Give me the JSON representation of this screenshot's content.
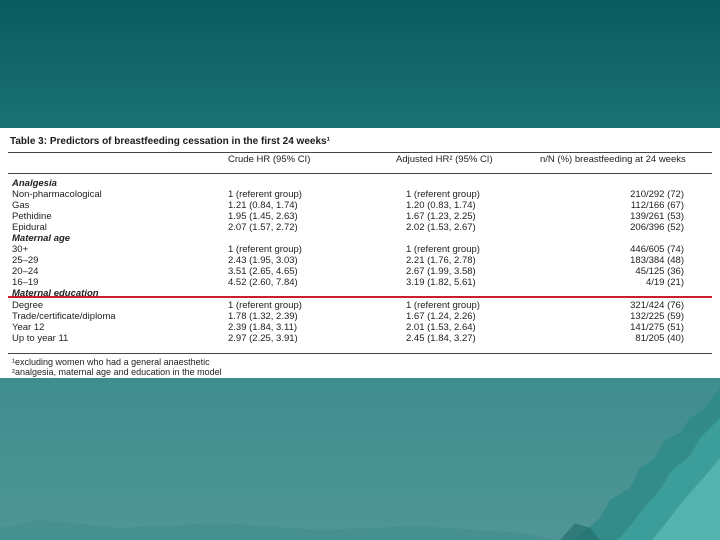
{
  "table": {
    "title": "Table 3: Predictors of breastfeeding cessation in the first 24 weeks¹",
    "columns": {
      "crude": "Crude HR (95% CI)",
      "adjusted": "Adjusted HR² (95% CI)",
      "n": "n/N (%) breastfeeding at 24 weeks"
    },
    "sections": [
      {
        "heading": "Analgesia",
        "rows": [
          {
            "label": "Non-pharmacological",
            "crude": "1 (referent group)",
            "adjusted": "1 (referent group)",
            "n": "210/292 (72)"
          },
          {
            "label": "Gas",
            "crude": "1.21 (0.84, 1.74)",
            "adjusted": "1.20 (0.83, 1.74)",
            "n": "112/166 (67)"
          },
          {
            "label": "Pethidine",
            "crude": "1.95 (1.45, 2.63)",
            "adjusted": "1.67 (1.23, 2.25)",
            "n": "139/261 (53)"
          },
          {
            "label": "Epidural",
            "crude": "2.07 (1.57, 2.72)",
            "adjusted": "2.02 (1.53, 2.67)",
            "n": "206/396 (52)"
          }
        ]
      },
      {
        "heading": "Maternal age",
        "rows": [
          {
            "label": "30+",
            "crude": "1 (referent group)",
            "adjusted": "1 (referent group)",
            "n": "446/605 (74)"
          },
          {
            "label": "25–29",
            "crude": "2.43 (1.95, 3.03)",
            "adjusted": "2.21 (1.76, 2.78)",
            "n": "183/384 (48)"
          },
          {
            "label": "20–24",
            "crude": "3.51 (2.65, 4.65)",
            "adjusted": "2.67 (1.99, 3.58)",
            "n": "45/125 (36)"
          },
          {
            "label": "16–19",
            "crude": "4.52 (2.60, 7.84)",
            "adjusted": "3.19 (1.82, 5.61)",
            "n": "4/19 (21)"
          }
        ]
      },
      {
        "heading": "Maternal education",
        "rows": [
          {
            "label": "Degree",
            "crude": "1 (referent group)",
            "adjusted": "1 (referent group)",
            "n": "321/424 (76)"
          },
          {
            "label": "Trade/certificate/diploma",
            "crude": "1.78 (1.32, 2.39)",
            "adjusted": "1.67 (1.24, 2.26)",
            "n": "132/225 (59)"
          },
          {
            "label": "Year 12",
            "crude": "2.39 (1.84, 3.11)",
            "adjusted": "2.01 (1.53, 2.64)",
            "n": "141/275 (51)"
          },
          {
            "label": "Up to year 11",
            "crude": "2.97 (2.25, 3.91)",
            "adjusted": "2.45 (1.84, 3.27)",
            "n": "81/205 (40)"
          }
        ]
      }
    ],
    "footnotes": [
      "¹excluding women who had a general anaesthetic",
      "²analgesia, maternal age and education in the model"
    ]
  },
  "colors": {
    "background_top": "#0a5c5e",
    "background_bottom": "#4f9696",
    "highlight_line": "#c8202a"
  }
}
